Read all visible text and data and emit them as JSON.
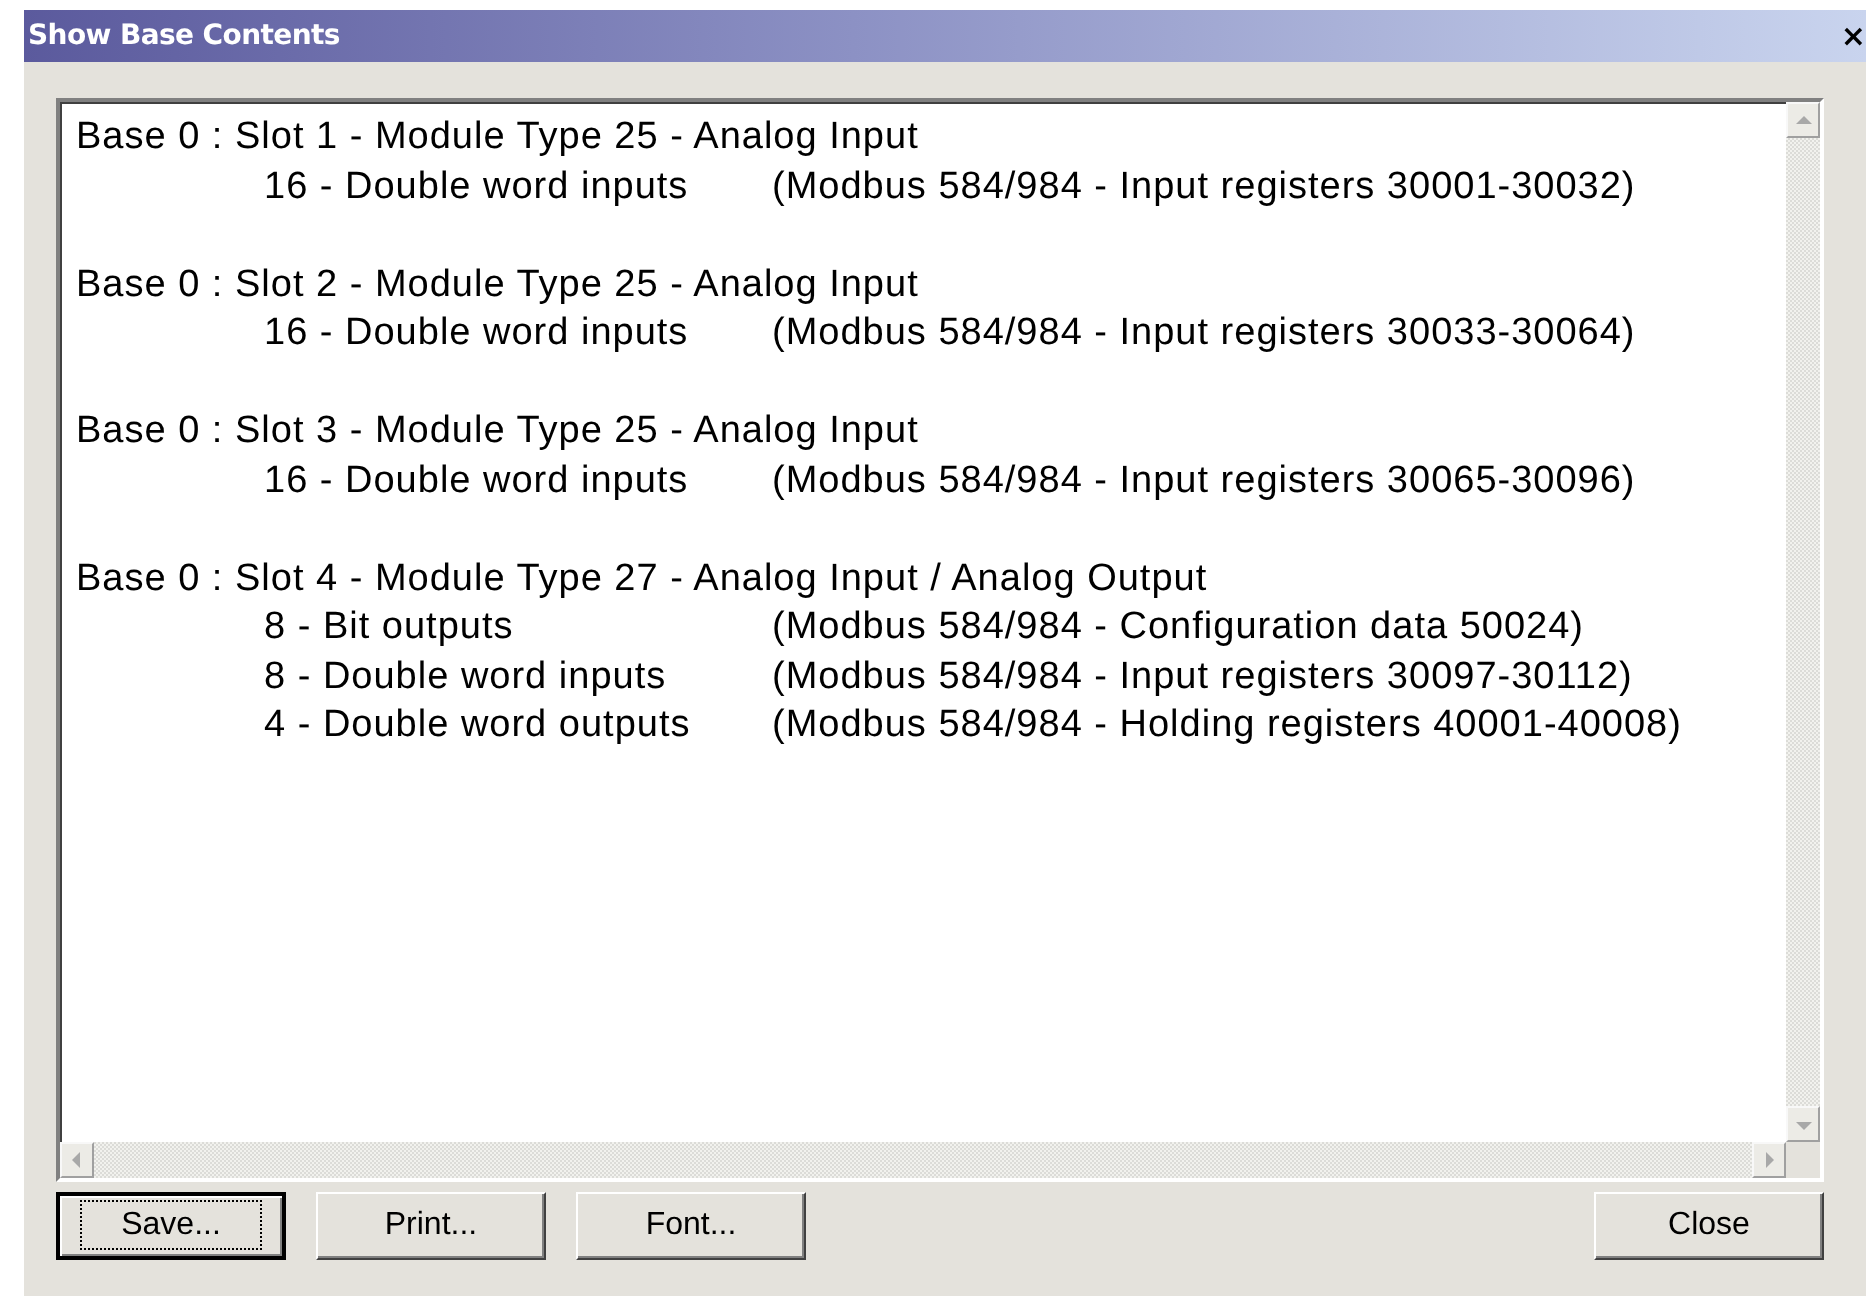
{
  "window": {
    "title": "Show Base Contents",
    "close": "×"
  },
  "modules": [
    {
      "header": "Base 0 : Slot 1 - Module Type 25 - Analog Input",
      "details": [
        {
          "item": "16 - Double word inputs",
          "registers": "(Modbus 584/984 - Input registers 30001-30032)"
        }
      ]
    },
    {
      "header": "Base 0 : Slot 2 - Module Type 25 - Analog Input",
      "details": [
        {
          "item": "16 - Double word inputs",
          "registers": "(Modbus 584/984 - Input registers 30033-30064)"
        }
      ]
    },
    {
      "header": "Base 0 : Slot 3 - Module Type 25 - Analog Input",
      "details": [
        {
          "item": "16 - Double word inputs",
          "registers": "(Modbus 584/984 - Input registers 30065-30096)"
        }
      ]
    },
    {
      "header": "Base 0 : Slot 4 - Module Type 27 - Analog Input / Analog Output",
      "details": [
        {
          "item": "8 - Bit outputs",
          "registers": "(Modbus 584/984 - Configuration data 50024)"
        },
        {
          "item": "8 - Double word inputs",
          "registers": "(Modbus 584/984 - Input registers 30097-30112)"
        },
        {
          "item": "4 - Double word outputs",
          "registers": "(Modbus 584/984 - Holding registers 40001-40008)"
        }
      ]
    }
  ],
  "buttons": [
    {
      "label": "Save...",
      "focused": true,
      "kind": "left"
    },
    {
      "label": "Print...",
      "focused": false,
      "kind": "left"
    },
    {
      "label": "Font...",
      "focused": false,
      "kind": "left"
    },
    {
      "label": "Close",
      "focused": false,
      "kind": "right"
    }
  ]
}
